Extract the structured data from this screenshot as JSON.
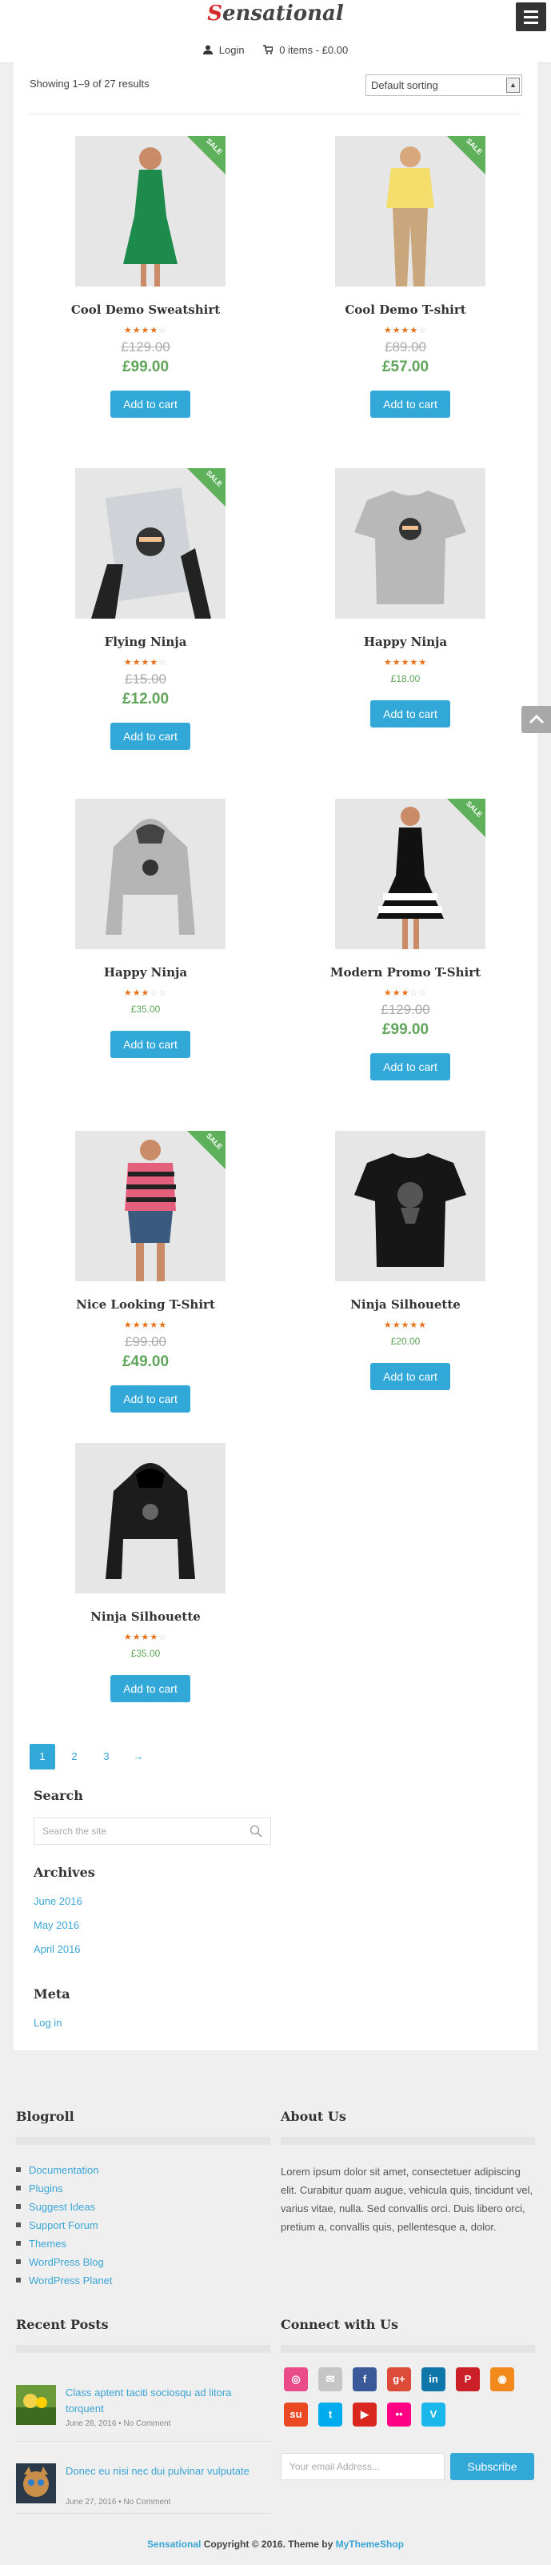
{
  "header": {
    "logo_first": "S",
    "logo_rest": "ensational",
    "login": "Login",
    "cart": "0 items - £0.00"
  },
  "shop": {
    "showing": "Showing 1–9 of 27 results",
    "sort_value": "Default sorting",
    "sale_label": "SALE",
    "add_to_cart": "Add to cart"
  },
  "products": [
    {
      "name": "Cool Demo Sweatshirt",
      "rating": 4,
      "old_price": "£129.00",
      "price": "£99.00",
      "sale": true
    },
    {
      "name": "Cool Demo T-shirt",
      "rating": 4,
      "old_price": "£89.00",
      "price": "£57.00",
      "sale": true
    },
    {
      "name": "Flying Ninja",
      "rating": 4,
      "old_price": "£15.00",
      "price": "£12.00",
      "sale": true
    },
    {
      "name": "Happy Ninja",
      "rating": 5,
      "old_price": "",
      "price": "£18.00",
      "sale": false
    },
    {
      "name": "Happy Ninja",
      "rating": 3,
      "old_price": "",
      "price": "£35.00",
      "sale": false
    },
    {
      "name": "Modern Promo T-Shirt",
      "rating": 3,
      "old_price": "£129.00",
      "price": "£99.00",
      "sale": true
    },
    {
      "name": "Nice Looking T-Shirt",
      "rating": 5,
      "old_price": "£99.00",
      "price": "£49.00",
      "sale": true
    },
    {
      "name": "Ninja Silhouette",
      "rating": 5,
      "old_price": "",
      "price": "£20.00",
      "sale": false
    },
    {
      "name": "Ninja Silhouette",
      "rating": 4,
      "old_price": "",
      "price": "£35.00",
      "sale": false
    }
  ],
  "pagination": {
    "pages": [
      "1",
      "2",
      "3"
    ],
    "current": "1",
    "next": "→"
  },
  "sidebar": {
    "search_title": "Search",
    "search_placeholder": "Search the site",
    "archives_title": "Archives",
    "archives": [
      "June 2016",
      "May 2016",
      "April 2016"
    ],
    "meta_title": "Meta",
    "meta_links": [
      "Log in"
    ]
  },
  "footer": {
    "blogroll_title": "Blogroll",
    "blogroll": [
      "Documentation",
      "Plugins",
      "Suggest Ideas",
      "Support Forum",
      "Themes",
      "WordPress Blog",
      "WordPress Planet"
    ],
    "about_title": "About Us",
    "about_text": "Lorem ipsum dolor sit amet, consectetuer adipiscing elit. Curabitur quam augue, vehicula quis, tincidunt vel, varius vitae, nulla. Sed convallis orci. Duis libero orci, pretium a, convallis quis, pellentesque a, dolor.",
    "recent_title": "Recent Posts",
    "posts": [
      {
        "title": "Class aptent taciti sociosqu ad litora torquent",
        "date": "June 28, 2016",
        "comments": "No Comment"
      },
      {
        "title": "Donec eu nisi nec dui pulvinar vulputate",
        "date": "June 27, 2016",
        "comments": "No Comment"
      }
    ],
    "connect_title": "Connect with Us",
    "social_icons": [
      "dribbble-icon",
      "email-icon",
      "facebook-icon",
      "google-plus-icon",
      "linkedin-icon",
      "pinterest-icon",
      "rss-icon",
      "stumbleupon-icon",
      "twitter-icon",
      "youtube-icon",
      "flickr-icon",
      "vimeo-icon"
    ],
    "email_placeholder": "Your email Address...",
    "subscribe": "Subscribe",
    "copyright_site": "Sensational",
    "copyright_text": " Copyright © 2016. Theme by ",
    "copyright_author": "MyThemeShop"
  },
  "colors": {
    "accent": "#32a8d9",
    "sale_green": "#5fb05a",
    "price_green": "#5fa55a",
    "star": "#e7711b",
    "logo_red": "#d32b2b"
  }
}
